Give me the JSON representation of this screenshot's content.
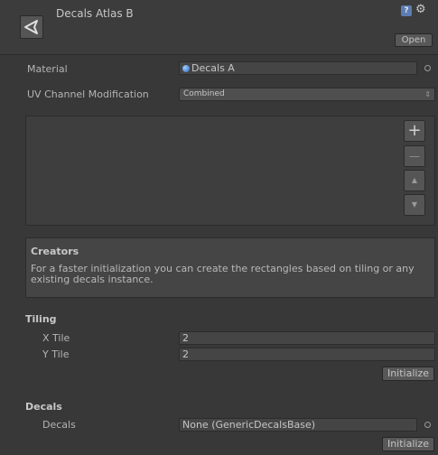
{
  "header": {
    "title": "Decals Atlas B",
    "help_glyph": "?",
    "gear_glyph": "⚙",
    "open_label": "Open"
  },
  "material": {
    "label": "Material",
    "value": "Decals A"
  },
  "uv_channel": {
    "label": "UV Channel Modification",
    "value": "Combined"
  },
  "list": {
    "add_glyph": "+",
    "remove_glyph": "—",
    "up_glyph": "▲",
    "down_glyph": "▼"
  },
  "creators": {
    "title": "Creators",
    "text": "For a faster initialization you can create the rectangles based on tiling or any existing decals instance."
  },
  "tiling": {
    "title": "Tiling",
    "x_label": "X Tile",
    "x_value": "2",
    "y_label": "Y Tile",
    "y_value": "2",
    "initialize_label": "Initialize"
  },
  "decals": {
    "title": "Decals",
    "label": "Decals",
    "value": "None (GenericDecalsBase)",
    "initialize_label": "Initialize"
  }
}
